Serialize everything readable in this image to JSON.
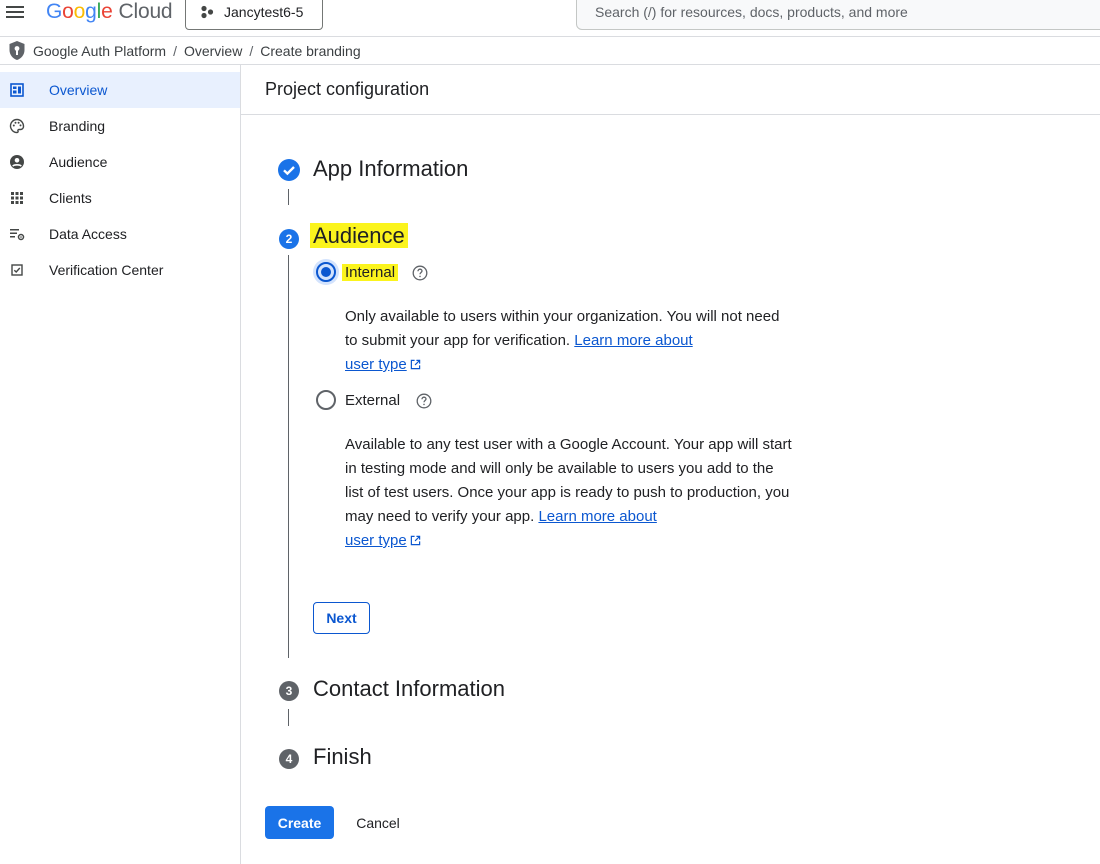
{
  "header": {
    "logo_letters": [
      "G",
      "o",
      "o",
      "g",
      "l",
      "e"
    ],
    "logo_product": "Cloud",
    "project_name": "Jancytest6-5",
    "search_placeholder": "Search (/) for resources, docs, products, and more"
  },
  "breadcrumb": {
    "items": [
      "Google Auth Platform",
      "Overview",
      "Create branding"
    ],
    "separator": "/"
  },
  "sidebar": {
    "items": [
      {
        "label": "Overview",
        "icon": "dashboard-icon",
        "active": true
      },
      {
        "label": "Branding",
        "icon": "palette-icon",
        "active": false
      },
      {
        "label": "Audience",
        "icon": "person-icon",
        "active": false
      },
      {
        "label": "Clients",
        "icon": "apps-grid-icon",
        "active": false
      },
      {
        "label": "Data Access",
        "icon": "list-settings-icon",
        "active": false
      },
      {
        "label": "Verification Center",
        "icon": "checkbox-icon",
        "active": false
      }
    ]
  },
  "main": {
    "title": "Project configuration",
    "steps": [
      {
        "number": "1",
        "title": "App Information",
        "state": "completed"
      },
      {
        "number": "2",
        "title": "Audience",
        "state": "current"
      },
      {
        "number": "3",
        "title": "Contact Information",
        "state": "pending"
      },
      {
        "number": "4",
        "title": "Finish",
        "state": "pending"
      }
    ],
    "audience": {
      "selected": "internal",
      "internal": {
        "label": "Internal",
        "desc": "Only available to users within your organization. You will not need to submit your app for verification.",
        "link_line1": "Learn more about",
        "link_line2": "user type"
      },
      "external": {
        "label": "External",
        "desc": "Available to any test user with a Google Account. Your app will start in testing mode and will only be available to users you add to the list of test users. Once your app is ready to push to production, you may need to verify your app.",
        "link_line1": "Learn more about",
        "link_line2": "user type"
      },
      "next_label": "Next"
    },
    "create_label": "Create",
    "cancel_label": "Cancel"
  },
  "colors": {
    "accent": "#1a73e8",
    "link": "#0b57d0",
    "highlight": "#fbf41d",
    "nav_active_bg": "#e8f0fe"
  }
}
